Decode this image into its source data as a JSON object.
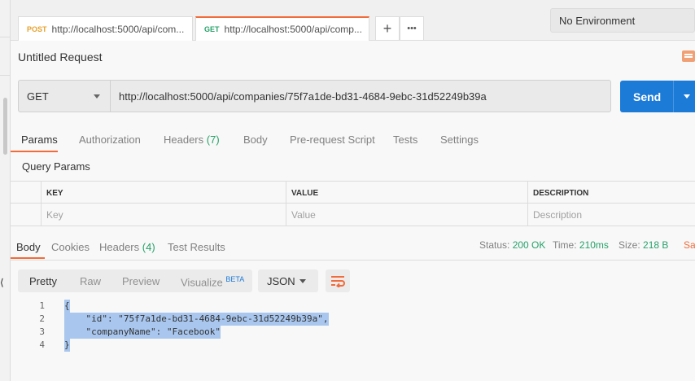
{
  "tabs": [
    {
      "method": "POST",
      "title": "http://localhost:5000/api/com...",
      "method_color": "#e6a12b"
    },
    {
      "method": "GET",
      "title": "http://localhost:5000/api/comp...",
      "method_color": "#26a269"
    }
  ],
  "tab_actions": {
    "add": "+",
    "more": "•••"
  },
  "environment": "No Environment",
  "request": {
    "title": "Untitled Request",
    "method": "GET",
    "url": "http://localhost:5000/api/companies/75f7a1de-bd31-4684-9ebc-31d52249b39a",
    "send_label": "Send"
  },
  "request_tabs": {
    "params": "Params",
    "authorization": "Authorization",
    "headers": "Headers",
    "headers_count": "(7)",
    "body": "Body",
    "pre_request": "Pre-request Script",
    "tests": "Tests",
    "settings": "Settings"
  },
  "query_params": {
    "title": "Query Params",
    "columns": [
      "KEY",
      "VALUE",
      "DESCRIPTION"
    ],
    "placeholders": [
      "Key",
      "Value",
      "Description"
    ]
  },
  "response_tabs": {
    "body": "Body",
    "cookies": "Cookies",
    "headers": "Headers",
    "headers_count": "(4)",
    "test_results": "Test Results"
  },
  "status": {
    "status_label": "Status:",
    "status_value": "200 OK",
    "time_label": "Time:",
    "time_value": "210ms",
    "size_label": "Size:",
    "size_value": "218 B",
    "save_cut": "Sa"
  },
  "view_options": {
    "pretty": "Pretty",
    "raw": "Raw",
    "preview": "Preview",
    "visualize": "Visualize",
    "beta": "BETA",
    "format": "JSON"
  },
  "code_lines": [
    {
      "num": "1",
      "text": "{"
    },
    {
      "num": "2",
      "text": "    \"id\": \"75f7a1de-bd31-4684-9ebc-31d52249b39a\","
    },
    {
      "num": "3",
      "text": "    \"companyName\": \"Facebook\""
    },
    {
      "num": "4",
      "text": "}"
    }
  ],
  "colors": {
    "accent": "#f26b3a",
    "send": "#1d7bd8",
    "success": "#26a269"
  }
}
